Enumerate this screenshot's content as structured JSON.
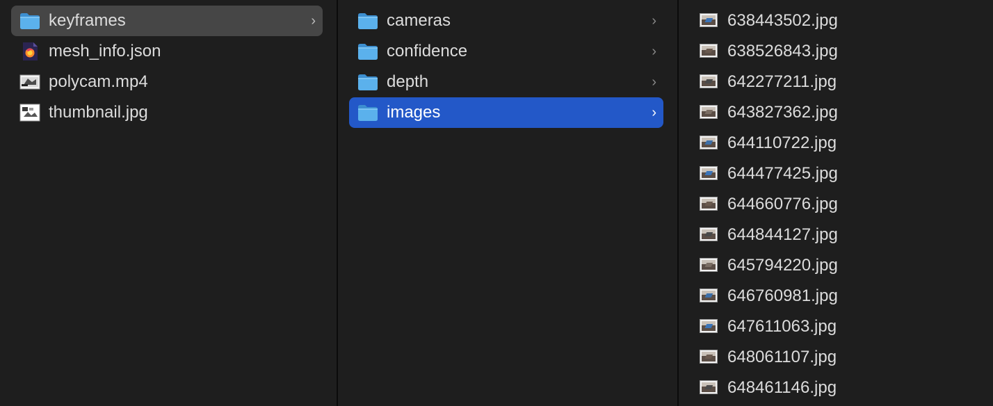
{
  "columns": [
    {
      "items": [
        {
          "name": "keyframes",
          "type": "folder",
          "selected": "inactive",
          "has_chevron": true
        },
        {
          "name": "mesh_info.json",
          "type": "json",
          "selected": "",
          "has_chevron": false
        },
        {
          "name": "polycam.mp4",
          "type": "video",
          "selected": "",
          "has_chevron": false
        },
        {
          "name": "thumbnail.jpg",
          "type": "image",
          "selected": "",
          "has_chevron": false
        }
      ]
    },
    {
      "items": [
        {
          "name": "cameras",
          "type": "folder",
          "selected": "",
          "has_chevron": true
        },
        {
          "name": "confidence",
          "type": "folder",
          "selected": "",
          "has_chevron": true
        },
        {
          "name": "depth",
          "type": "folder",
          "selected": "",
          "has_chevron": true
        },
        {
          "name": "images",
          "type": "folder",
          "selected": "active",
          "has_chevron": true
        }
      ]
    },
    {
      "items": [
        {
          "name": "638443502.jpg",
          "type": "image-thumb"
        },
        {
          "name": "638526843.jpg",
          "type": "image-thumb"
        },
        {
          "name": "642277211.jpg",
          "type": "image-thumb"
        },
        {
          "name": "643827362.jpg",
          "type": "image-thumb"
        },
        {
          "name": "644110722.jpg",
          "type": "image-thumb"
        },
        {
          "name": "644477425.jpg",
          "type": "image-thumb"
        },
        {
          "name": "644660776.jpg",
          "type": "image-thumb"
        },
        {
          "name": "644844127.jpg",
          "type": "image-thumb"
        },
        {
          "name": "645794220.jpg",
          "type": "image-thumb"
        },
        {
          "name": "646760981.jpg",
          "type": "image-thumb"
        },
        {
          "name": "647611063.jpg",
          "type": "image-thumb"
        },
        {
          "name": "648061107.jpg",
          "type": "image-thumb"
        },
        {
          "name": "648461146.jpg",
          "type": "image-thumb"
        }
      ]
    }
  ],
  "icons": {
    "folder": "folder-icon",
    "json": "json-file-icon",
    "video": "video-file-icon",
    "image": "image-file-icon",
    "image-thumb": "image-thumbnail-icon",
    "chevron": "chevron-right-icon"
  },
  "colors": {
    "background": "#1e1e1e",
    "selection_active": "#2358c8",
    "selection_inactive": "#464646",
    "folder_blue": "#4fa8e8",
    "text": "#dcdcdc"
  }
}
